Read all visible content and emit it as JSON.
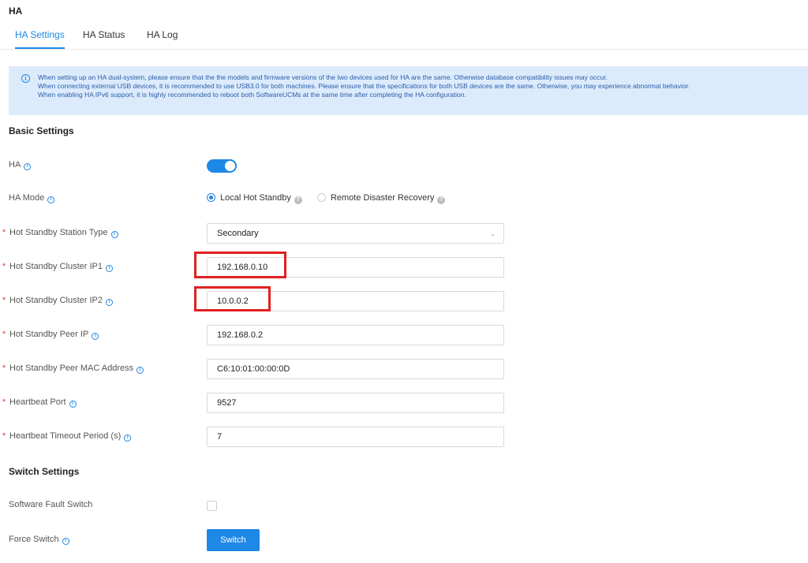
{
  "page": {
    "title": "HA"
  },
  "tabs": [
    {
      "label": "HA Settings",
      "active": true
    },
    {
      "label": "HA Status",
      "active": false
    },
    {
      "label": "HA Log",
      "active": false
    }
  ],
  "notice": {
    "lines": [
      "When setting up an HA dual-system, please ensure that the the models and firmware versions of the two devices used for HA are the same. Otherwise database compatibility issues may occur.",
      "When connecting external USB devices, it is recommended to use USB3.0 for both machines. Please ensure that the specifications for both USB devices are the same. Otherwise, you may experience abnormal behavior.",
      "When enabling HA IPv6 support, it is highly recommended to reboot both SoftwareUCMs at the same time after completing the HA configuration."
    ]
  },
  "basic_settings": {
    "title": "Basic Settings",
    "ha": {
      "label": "HA",
      "enabled": true
    },
    "ha_mode": {
      "label": "HA Mode",
      "options": [
        "Local Hot Standby",
        "Remote Disaster Recovery"
      ],
      "selected": "Local Hot Standby"
    },
    "station_type": {
      "label": "Hot Standby Station Type",
      "value": "Secondary"
    },
    "cluster_ip1": {
      "label": "Hot Standby Cluster IP1",
      "value": "192.168.0.10"
    },
    "cluster_ip2": {
      "label": "Hot Standby Cluster IP2",
      "value": "10.0.0.2"
    },
    "peer_ip": {
      "label": "Hot Standby Peer IP",
      "value": "192.168.0.2"
    },
    "peer_mac": {
      "label": "Hot Standby Peer MAC Address",
      "value": "C6:10:01:00:00:0D"
    },
    "heartbeat_port": {
      "label": "Heartbeat Port",
      "value": "9527"
    },
    "heartbeat_timeout": {
      "label": "Heartbeat Timeout Period (s)",
      "value": "7"
    }
  },
  "switch_settings": {
    "title": "Switch Settings",
    "software_fault_switch": {
      "label": "Software Fault Switch",
      "checked": false
    },
    "force_switch": {
      "label": "Force Switch",
      "button_label": "Switch"
    }
  },
  "colors": {
    "accent": "#1e88e5",
    "notice_bg": "#dcebfc",
    "highlight": "#e02020",
    "required": "#e53935"
  }
}
